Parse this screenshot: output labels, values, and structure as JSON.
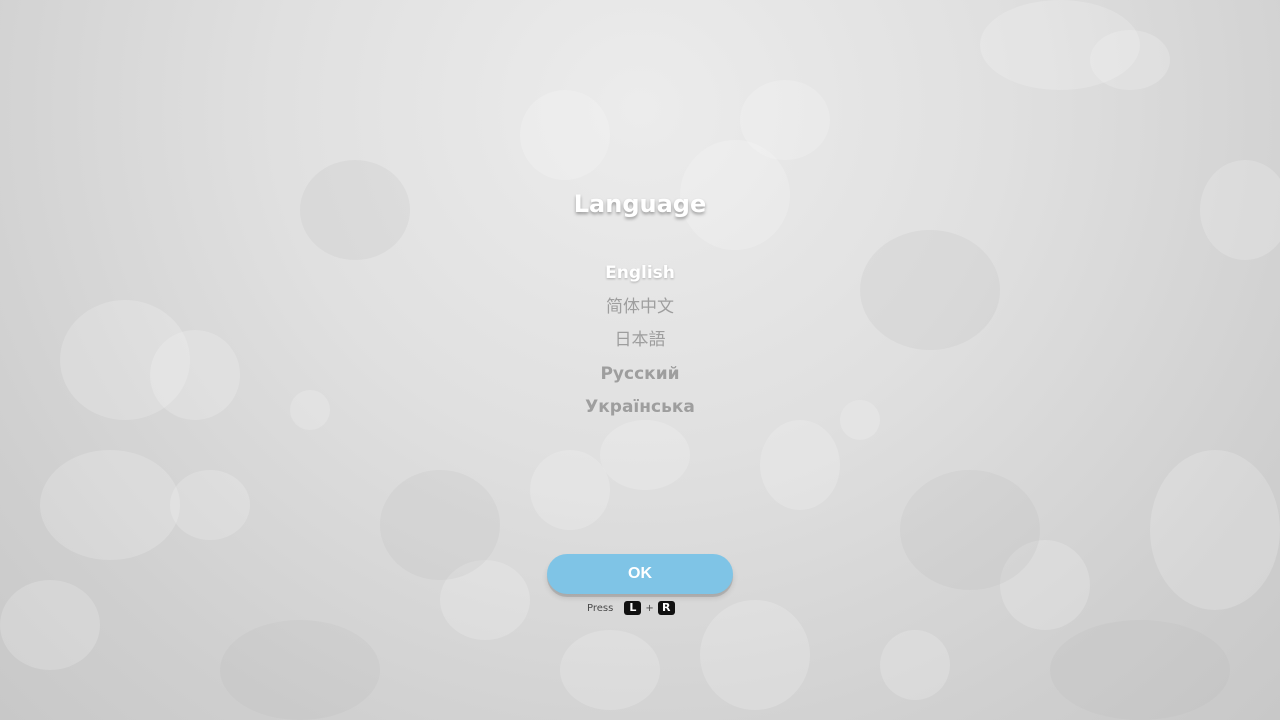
{
  "title": "Language",
  "languages": [
    {
      "label": "English",
      "selected": true
    },
    {
      "label": "简体中文",
      "selected": false
    },
    {
      "label": "日本語",
      "selected": false
    },
    {
      "label": "Русский",
      "selected": false
    },
    {
      "label": "Українська",
      "selected": false
    }
  ],
  "ok_button": {
    "label": "OK",
    "color": "#7fc4e6"
  },
  "hint": {
    "press_label": "Press",
    "key_left": "L",
    "plus": "+",
    "key_right": "R"
  }
}
